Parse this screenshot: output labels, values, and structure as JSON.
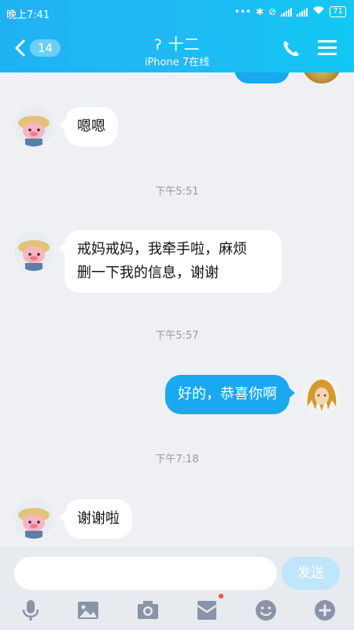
{
  "status": {
    "time": "晚上7:41",
    "battery": "71"
  },
  "header": {
    "back_count": "14",
    "title": "十二",
    "subtitle": "iPhone 7在线"
  },
  "messages": [
    {
      "side": "left",
      "text": "嗯嗯"
    },
    {
      "timestamp": "下午5:51"
    },
    {
      "side": "left",
      "lines": [
        "戒妈戒妈，我牵手啦，麻烦",
        "删一下我的信息，谢谢"
      ]
    },
    {
      "timestamp": "下午5:57"
    },
    {
      "side": "right",
      "text": "好的，恭喜你啊"
    },
    {
      "timestamp": "下午7:18"
    },
    {
      "side": "left",
      "text": "谢谢啦"
    }
  ],
  "input": {
    "placeholder": "",
    "send_label": "发送"
  },
  "toolbar": [
    "microphone-icon",
    "image-icon",
    "camera-icon",
    "red-packet-icon",
    "emoji-icon",
    "plus-icon"
  ],
  "colors": {
    "header": "#1fb2f3",
    "bubble_right": "#1aa8f0",
    "send_disabled": "#bfe6fb"
  }
}
